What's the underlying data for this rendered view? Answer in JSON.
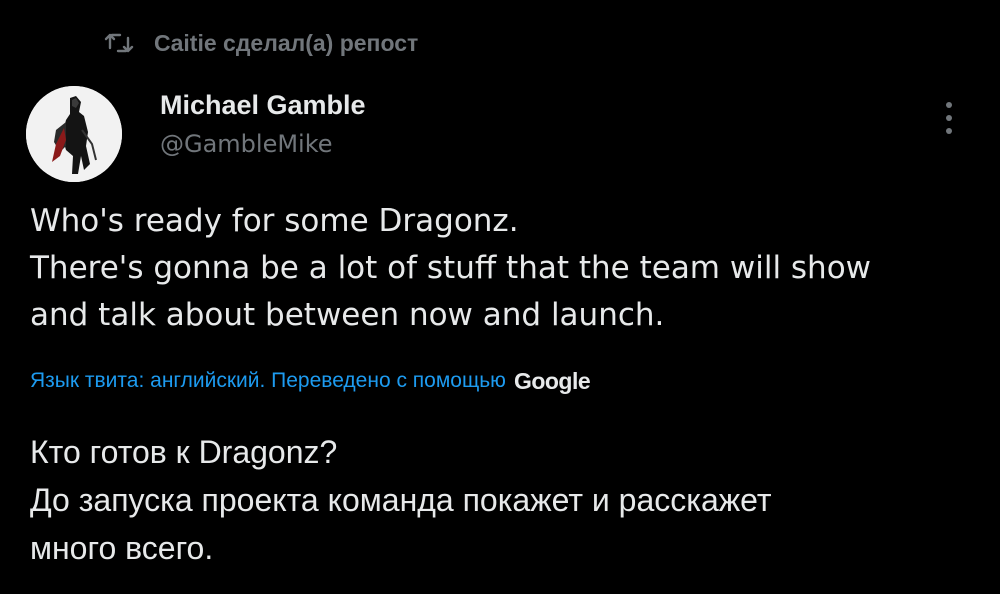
{
  "repost": {
    "icon": "repost-icon",
    "text": "Caitie сделал(а) репост"
  },
  "author": {
    "name": "Michael Gamble",
    "handle": "@GambleMike",
    "avatar": "avatar"
  },
  "menu": {
    "icon": "more-vertical-icon"
  },
  "tweet": {
    "lines": [
      "Who's ready for some Dragonz.",
      "There's gonna be a lot of stuff that the team will show",
      "and talk about between now and launch."
    ]
  },
  "translation": {
    "notice": "Язык твита: английский. Переведено с помощью",
    "provider": "Google",
    "lines": [
      "Кто готов к Dragonz?",
      "До запуска проекта команда покажет и расскажет",
      "много всего."
    ]
  },
  "colors": {
    "background": "#000000",
    "text": "#e7e9ea",
    "secondary": "#71767b",
    "link": "#1d9bf0"
  }
}
